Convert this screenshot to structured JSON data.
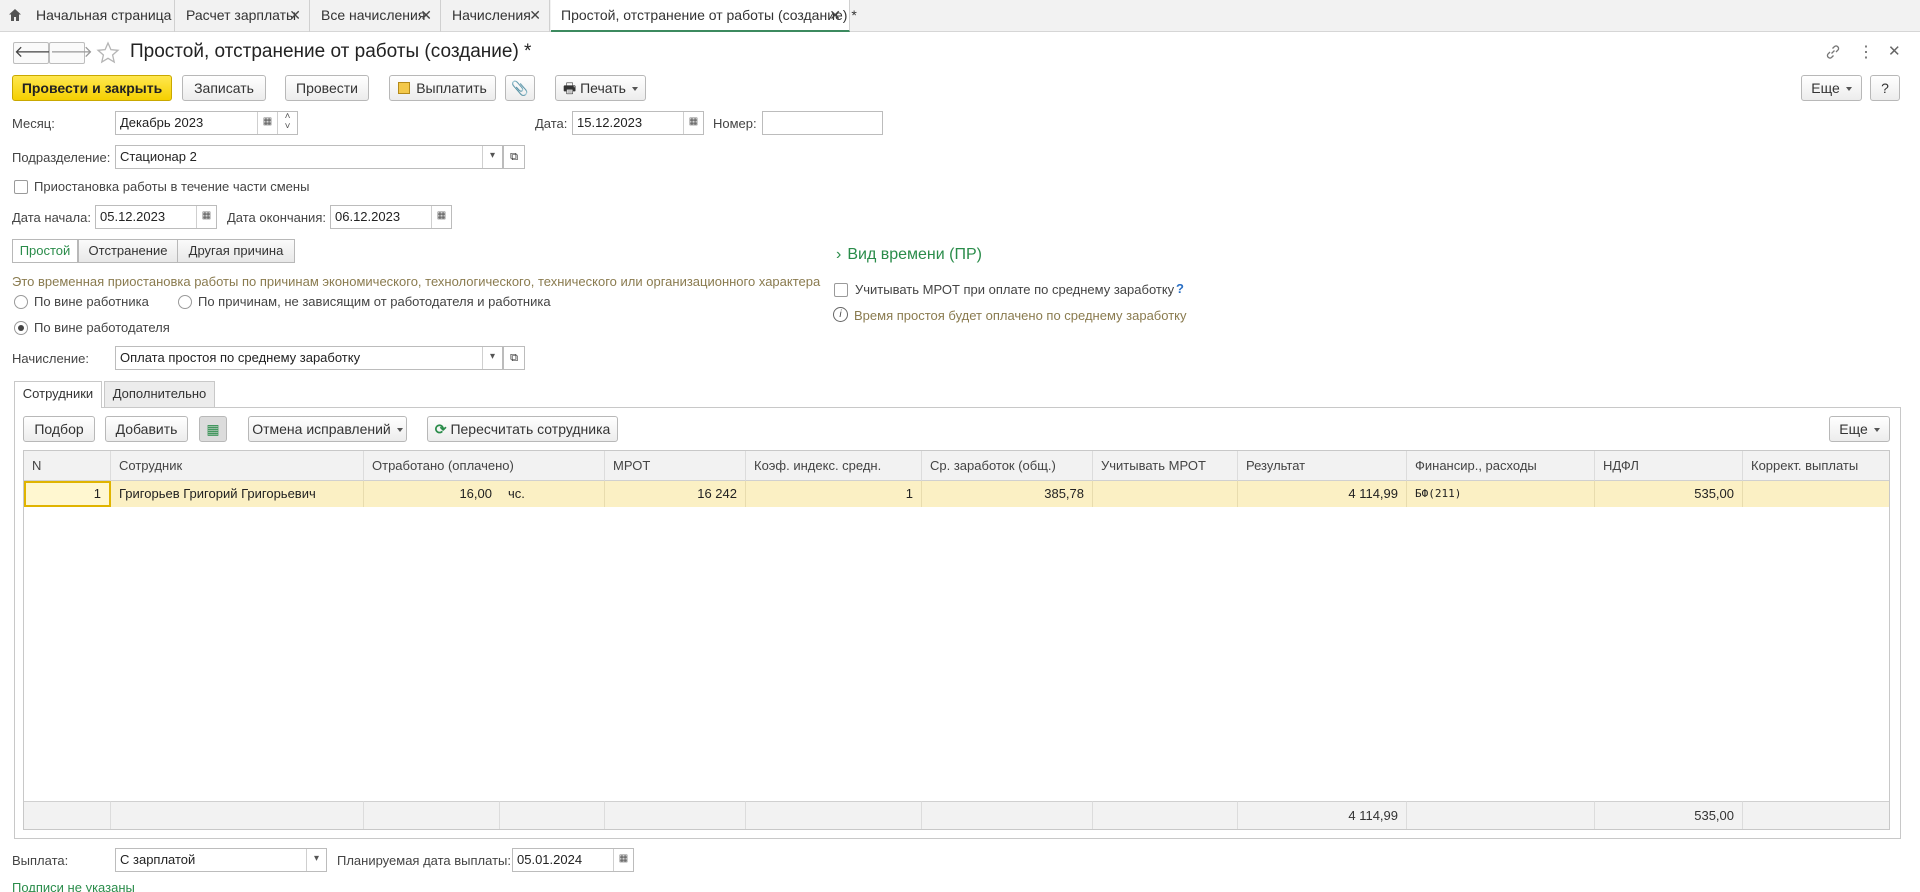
{
  "tabs": [
    {
      "label": "Начальная страница"
    },
    {
      "label": "Расчет зарплаты"
    },
    {
      "label": "Все начисления"
    },
    {
      "label": "Начисления"
    },
    {
      "label": "Простой, отстранение от работы (создание) *"
    }
  ],
  "page_title": "Простой, отстранение от работы (создание) *",
  "toolbar": {
    "post_close": "Провести и закрыть",
    "save": "Записать",
    "post": "Провести",
    "pay": "Выплатить",
    "print": "Печать",
    "more": "Еще",
    "help": "?"
  },
  "fields": {
    "month_label": "Месяц:",
    "month_value": "Декабрь 2023",
    "date_label": "Дата:",
    "date_value": "15.12.2023",
    "number_label": "Номер:",
    "number_value": "",
    "dept_label": "Подразделение:",
    "dept_value": "Стационар 2",
    "partial_shift_label": "Приостановка работы в течение части смены",
    "start_label": "Дата начала:",
    "start_value": "05.12.2023",
    "end_label": "Дата окончания:",
    "end_value": "06.12.2023"
  },
  "reason_toggle": [
    "Простой",
    "Отстранение",
    "Другая причина"
  ],
  "reason_hint": "Это временная приостановка работы по причинам экономического, технологического, технического или организационного характера",
  "radios": {
    "employee_fault": "По вине работника",
    "independent": "По причинам, не зависящим от работодателя и работника",
    "employer_fault": "По вине работодателя"
  },
  "right_panel": {
    "time_kind": "Вид времени (ПР)",
    "mrot_check": "Учитывать МРОТ при оплате по среднему заработку",
    "question": "?",
    "info": "Время простоя будет оплачено по среднему заработку"
  },
  "accrual": {
    "label": "Начисление:",
    "value": "Оплата простоя по среднему заработку"
  },
  "inner_tabs": [
    "Сотрудники",
    "Дополнительно"
  ],
  "table_toolbar": {
    "select": "Подбор",
    "add": "Добавить",
    "cancel_corrections": "Отмена исправлений",
    "recalc": "Пересчитать сотрудника",
    "more": "Еще"
  },
  "table": {
    "headers": [
      "N",
      "Сотрудник",
      "Отработано (оплачено)",
      "МРОТ",
      "Коэф. индекс. средн.",
      "Ср. заработок (общ.)",
      "Учитывать МРОТ",
      "Результат",
      "Финансир., расходы",
      "НДФЛ",
      "Коррект. выплаты"
    ],
    "rows": [
      {
        "n": "1",
        "employee": "Григорьев Григорий Григорьевич",
        "worked": "16,00",
        "unit": "чс.",
        "mrot": "16 242",
        "coef": "1",
        "avg": "385,78",
        "use_mrot": "",
        "result": "4 114,99",
        "finance": "БФ(211)",
        "ndfl": "535,00",
        "correct": ""
      }
    ],
    "totals": {
      "result": "4 114,99",
      "ndfl": "535,00"
    }
  },
  "payment": {
    "label": "Выплата:",
    "value": "С зарплатой",
    "planned_label": "Планируемая дата выплаты:",
    "planned_value": "05.01.2024"
  },
  "signatures": "Подписи не указаны"
}
